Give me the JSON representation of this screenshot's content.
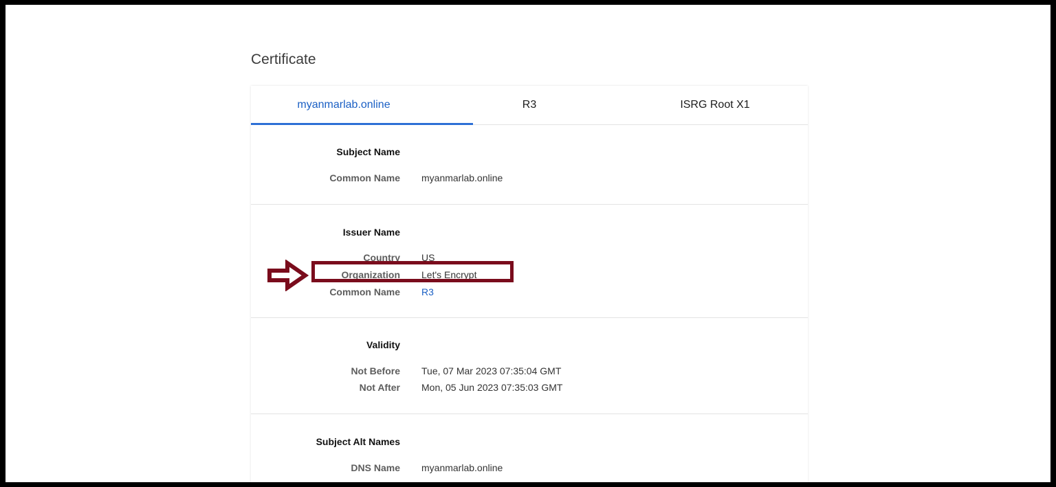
{
  "page": {
    "title": "Certificate"
  },
  "tabs": [
    {
      "label": "myanmarlab.online",
      "active": true
    },
    {
      "label": "R3",
      "active": false
    },
    {
      "label": "ISRG Root X1",
      "active": false
    }
  ],
  "sections": {
    "subject": {
      "title": "Subject Name",
      "rows": [
        {
          "label": "Common Name",
          "value": "myanmarlab.online"
        }
      ]
    },
    "issuer": {
      "title": "Issuer Name",
      "rows": [
        {
          "label": "Country",
          "value": "US"
        },
        {
          "label": "Organization",
          "value": "Let's Encrypt"
        },
        {
          "label": "Common Name",
          "value": "R3"
        }
      ]
    },
    "validity": {
      "title": "Validity",
      "rows": [
        {
          "label": "Not Before",
          "value": "Tue, 07 Mar 2023 07:35:04 GMT"
        },
        {
          "label": "Not After",
          "value": "Mon, 05 Jun 2023 07:35:03 GMT"
        }
      ]
    },
    "alt": {
      "title": "Subject Alt Names",
      "rows": [
        {
          "label": "DNS Name",
          "value": "myanmarlab.online"
        }
      ]
    }
  },
  "annotation": {
    "color": "#7a0c1c",
    "arrow_icon": "right-arrow-icon"
  }
}
